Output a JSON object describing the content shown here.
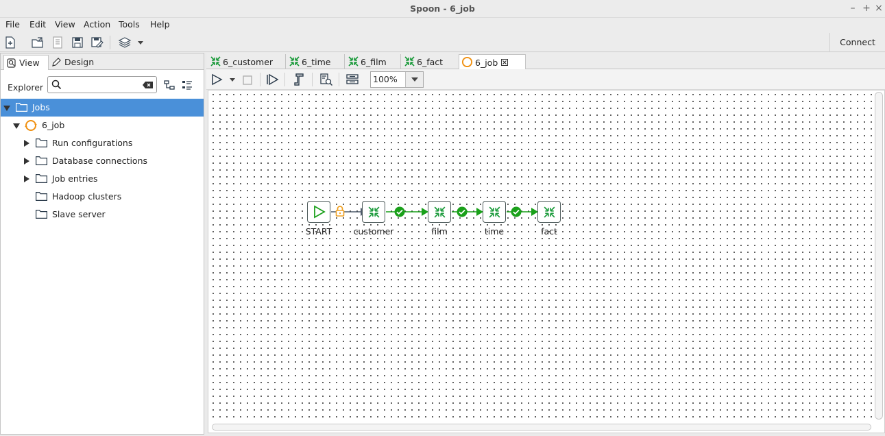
{
  "window": {
    "title": "Spoon - 6_job",
    "controls": [
      "–",
      "+",
      "×"
    ]
  },
  "menu": {
    "items": [
      "File",
      "Edit",
      "View",
      "Action",
      "Tools",
      "Help"
    ]
  },
  "toolbar": {
    "connect_label": "Connect"
  },
  "left": {
    "tabs": [
      {
        "label": "View"
      },
      {
        "label": "Design"
      }
    ],
    "explorer_label": "Explorer",
    "search_placeholder": "",
    "tree": [
      {
        "label": "Jobs"
      },
      {
        "label": "6_job"
      },
      {
        "label": "Run configurations"
      },
      {
        "label": "Database connections"
      },
      {
        "label": "Job entries"
      },
      {
        "label": "Hadoop clusters"
      },
      {
        "label": "Slave server"
      }
    ]
  },
  "job_tabs": [
    {
      "label": "6_customer"
    },
    {
      "label": "6_time"
    },
    {
      "label": "6_film"
    },
    {
      "label": "6_fact"
    },
    {
      "label": "6_job"
    }
  ],
  "job_toolbar": {
    "zoom": "100%"
  },
  "workflow": {
    "nodes": [
      {
        "label": "START"
      },
      {
        "label": "customer"
      },
      {
        "label": "film"
      },
      {
        "label": "time"
      },
      {
        "label": "fact"
      }
    ]
  },
  "colors": {
    "selection": "#4a90d9",
    "hop_ok": "#1aa01a",
    "hop_unconditional": "#4d5a6a",
    "lock": "#f0a020",
    "entry_icon": "#1a9a3a"
  }
}
